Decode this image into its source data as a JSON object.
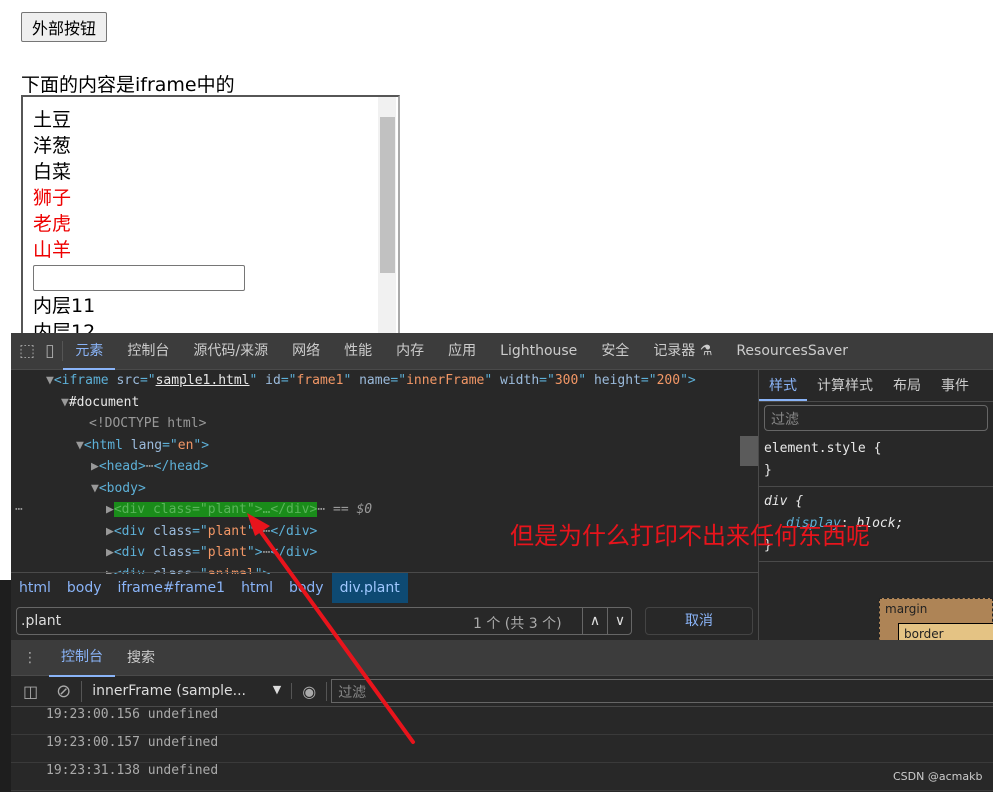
{
  "page": {
    "outer_button": "外部按钮",
    "iframe_label": "下面的内容是iframe中的",
    "iframe_items": [
      {
        "text": "土豆",
        "red": false
      },
      {
        "text": "洋葱",
        "red": false
      },
      {
        "text": "白菜",
        "red": false
      },
      {
        "text": "狮子",
        "red": true
      },
      {
        "text": "老虎",
        "red": true
      },
      {
        "text": "山羊",
        "red": true
      }
    ],
    "inner_items": [
      "内层11",
      "内层12"
    ]
  },
  "devtools": {
    "tabs": [
      "元素",
      "控制台",
      "源代码/来源",
      "网络",
      "性能",
      "内存",
      "应用",
      "Lighthouse",
      "安全",
      "记录器 ⚗",
      "ResourcesSaver"
    ],
    "active_tab": "元素",
    "tree": {
      "iframe_src": "sample1.html",
      "iframe_id": "frame1",
      "iframe_name": "innerFrame",
      "iframe_width": "300",
      "iframe_height": "200",
      "document": "#document",
      "doctype": "<!DOCTYPE html>",
      "html_lang": "en",
      "selected_marker": "== $0",
      "div_class_plant": "plant",
      "div_class_animal": "animal"
    },
    "styles_tabs": [
      "样式",
      "计算样式",
      "布局",
      "事件"
    ],
    "styles_filter": "过滤",
    "rule1_selector": "element.style {",
    "rule1_close": "}",
    "rule2_selector": "div {",
    "rule2_prop": "display",
    "rule2_val": "block;",
    "rule2_close": "}",
    "breadcrumbs": [
      "html",
      "body",
      "iframe#frame1",
      "html",
      "body",
      "div.plant"
    ],
    "search_value": ".plant",
    "search_count": "1 个 (共 3 个)",
    "cancel": "取消",
    "box_margin": "margin",
    "box_border": "border",
    "box_dash": "–",
    "drawer_tabs": [
      "控制台",
      "搜索"
    ],
    "console_context": "innerFrame (sample...",
    "console_filter": "过滤",
    "messages": [
      {
        "time": "19:23:00.156",
        "text": "undefined"
      },
      {
        "time": "19:23:00.157",
        "text": "undefined"
      },
      {
        "time": "19:23:31.138",
        "text": "undefined"
      }
    ]
  },
  "annotation": "但是为什么打印不出来任何东西呢",
  "watermark": "CSDN @acmakb",
  "colors": {
    "annotation": "#e8141c",
    "accent": "#8ab4f8",
    "selected": "#1a8c1a"
  }
}
